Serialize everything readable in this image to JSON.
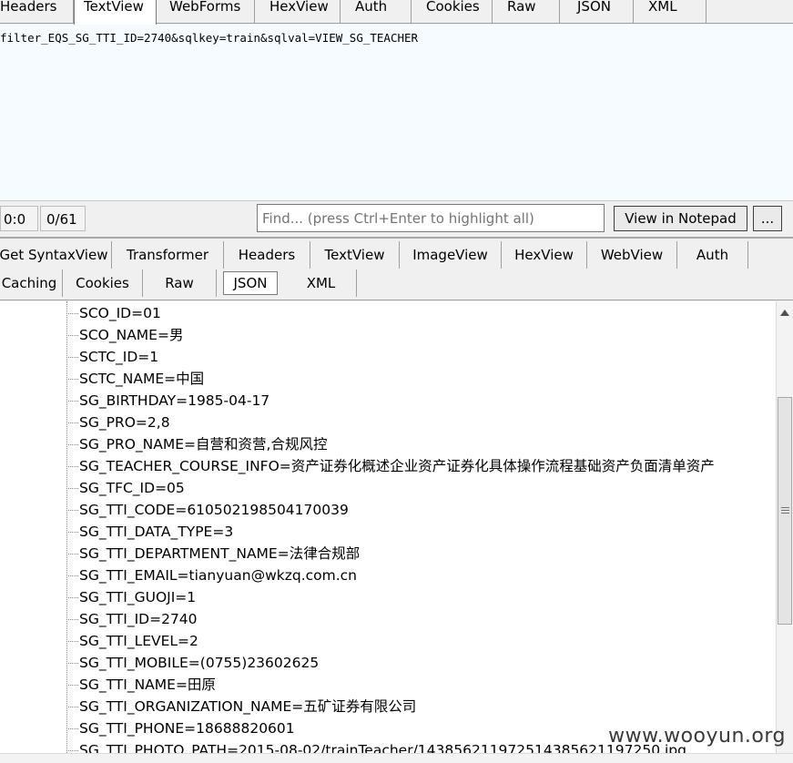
{
  "request_tabs": [
    "Headers",
    "TextView",
    "WebForms",
    "HexView",
    "Auth",
    "Cookies",
    "Raw",
    "JSON",
    "XML"
  ],
  "request_text": "filter_EQS_SG_TTI_ID=2740&sqlkey=train&sqlval=VIEW_SG_TEACHER",
  "status": {
    "position": "0:0",
    "count": "0/61"
  },
  "find": {
    "placeholder": "Find... (press Ctrl+Enter to highlight all)",
    "notepad_label": "View in Notepad",
    "more_label": "..."
  },
  "response_tabs_row1": [
    "Get SyntaxView",
    "Transformer",
    "Headers",
    "TextView",
    "ImageView",
    "HexView",
    "WebView",
    "Auth"
  ],
  "response_tabs_row2": [
    "Caching",
    "Cookies",
    "Raw",
    "JSON",
    "XML"
  ],
  "tree_nodes": [
    "SCO_ID=01",
    "SCO_NAME=男",
    "SCTC_ID=1",
    "SCTC_NAME=中国",
    "SG_BIRTHDAY=1985-04-17",
    "SG_PRO=2,8",
    "SG_PRO_NAME=自营和资营,合规风控",
    "SG_TEACHER_COURSE_INFO=资产证券化概述企业资产证券化具体操作流程基础资产负面清单资产",
    "SG_TFC_ID=05",
    "SG_TTI_CODE=610502198504170039",
    "SG_TTI_DATA_TYPE=3",
    "SG_TTI_DEPARTMENT_NAME=法律合规部",
    "SG_TTI_EMAIL=tianyuan@wkzq.com.cn",
    "SG_TTI_GUOJI=1",
    "SG_TTI_ID=2740",
    "SG_TTI_LEVEL=2",
    "SG_TTI_MOBILE=(0755)23602625",
    "SG_TTI_NAME=田原",
    "SG_TTI_ORGANIZATION_NAME=五矿证券有限公司",
    "SG_TTI_PHONE=18688820601",
    "SG_TTI_PHOTO_PATH=2015-08-02/trainTeacher/1438562119725143856211972​50.jpg"
  ],
  "watermark": "www.wooyun.org"
}
